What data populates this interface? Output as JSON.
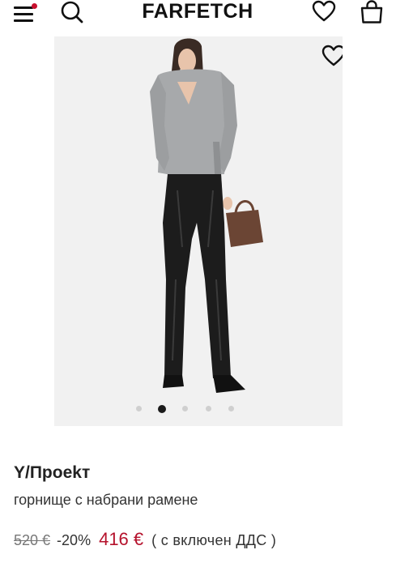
{
  "header": {
    "logo": "FARFETCH",
    "menu_icon": "hamburger-menu-icon",
    "search_icon": "search-icon",
    "wishlist_icon": "heart-icon",
    "bag_icon": "shopping-bag-icon",
    "notification_color": "#c8102e"
  },
  "gallery": {
    "image_description_icon": "product-photo",
    "favorite_icon": "heart-icon",
    "total_images": 5,
    "active_index": 1
  },
  "product": {
    "brand": "Y/Проеkт",
    "name": "горнище с набрани рамене",
    "old_price": "520 €",
    "discount": "-20%",
    "new_price": "416 €",
    "vat_note": "( с включен ДДС )",
    "sale_color": "#b5122c"
  }
}
